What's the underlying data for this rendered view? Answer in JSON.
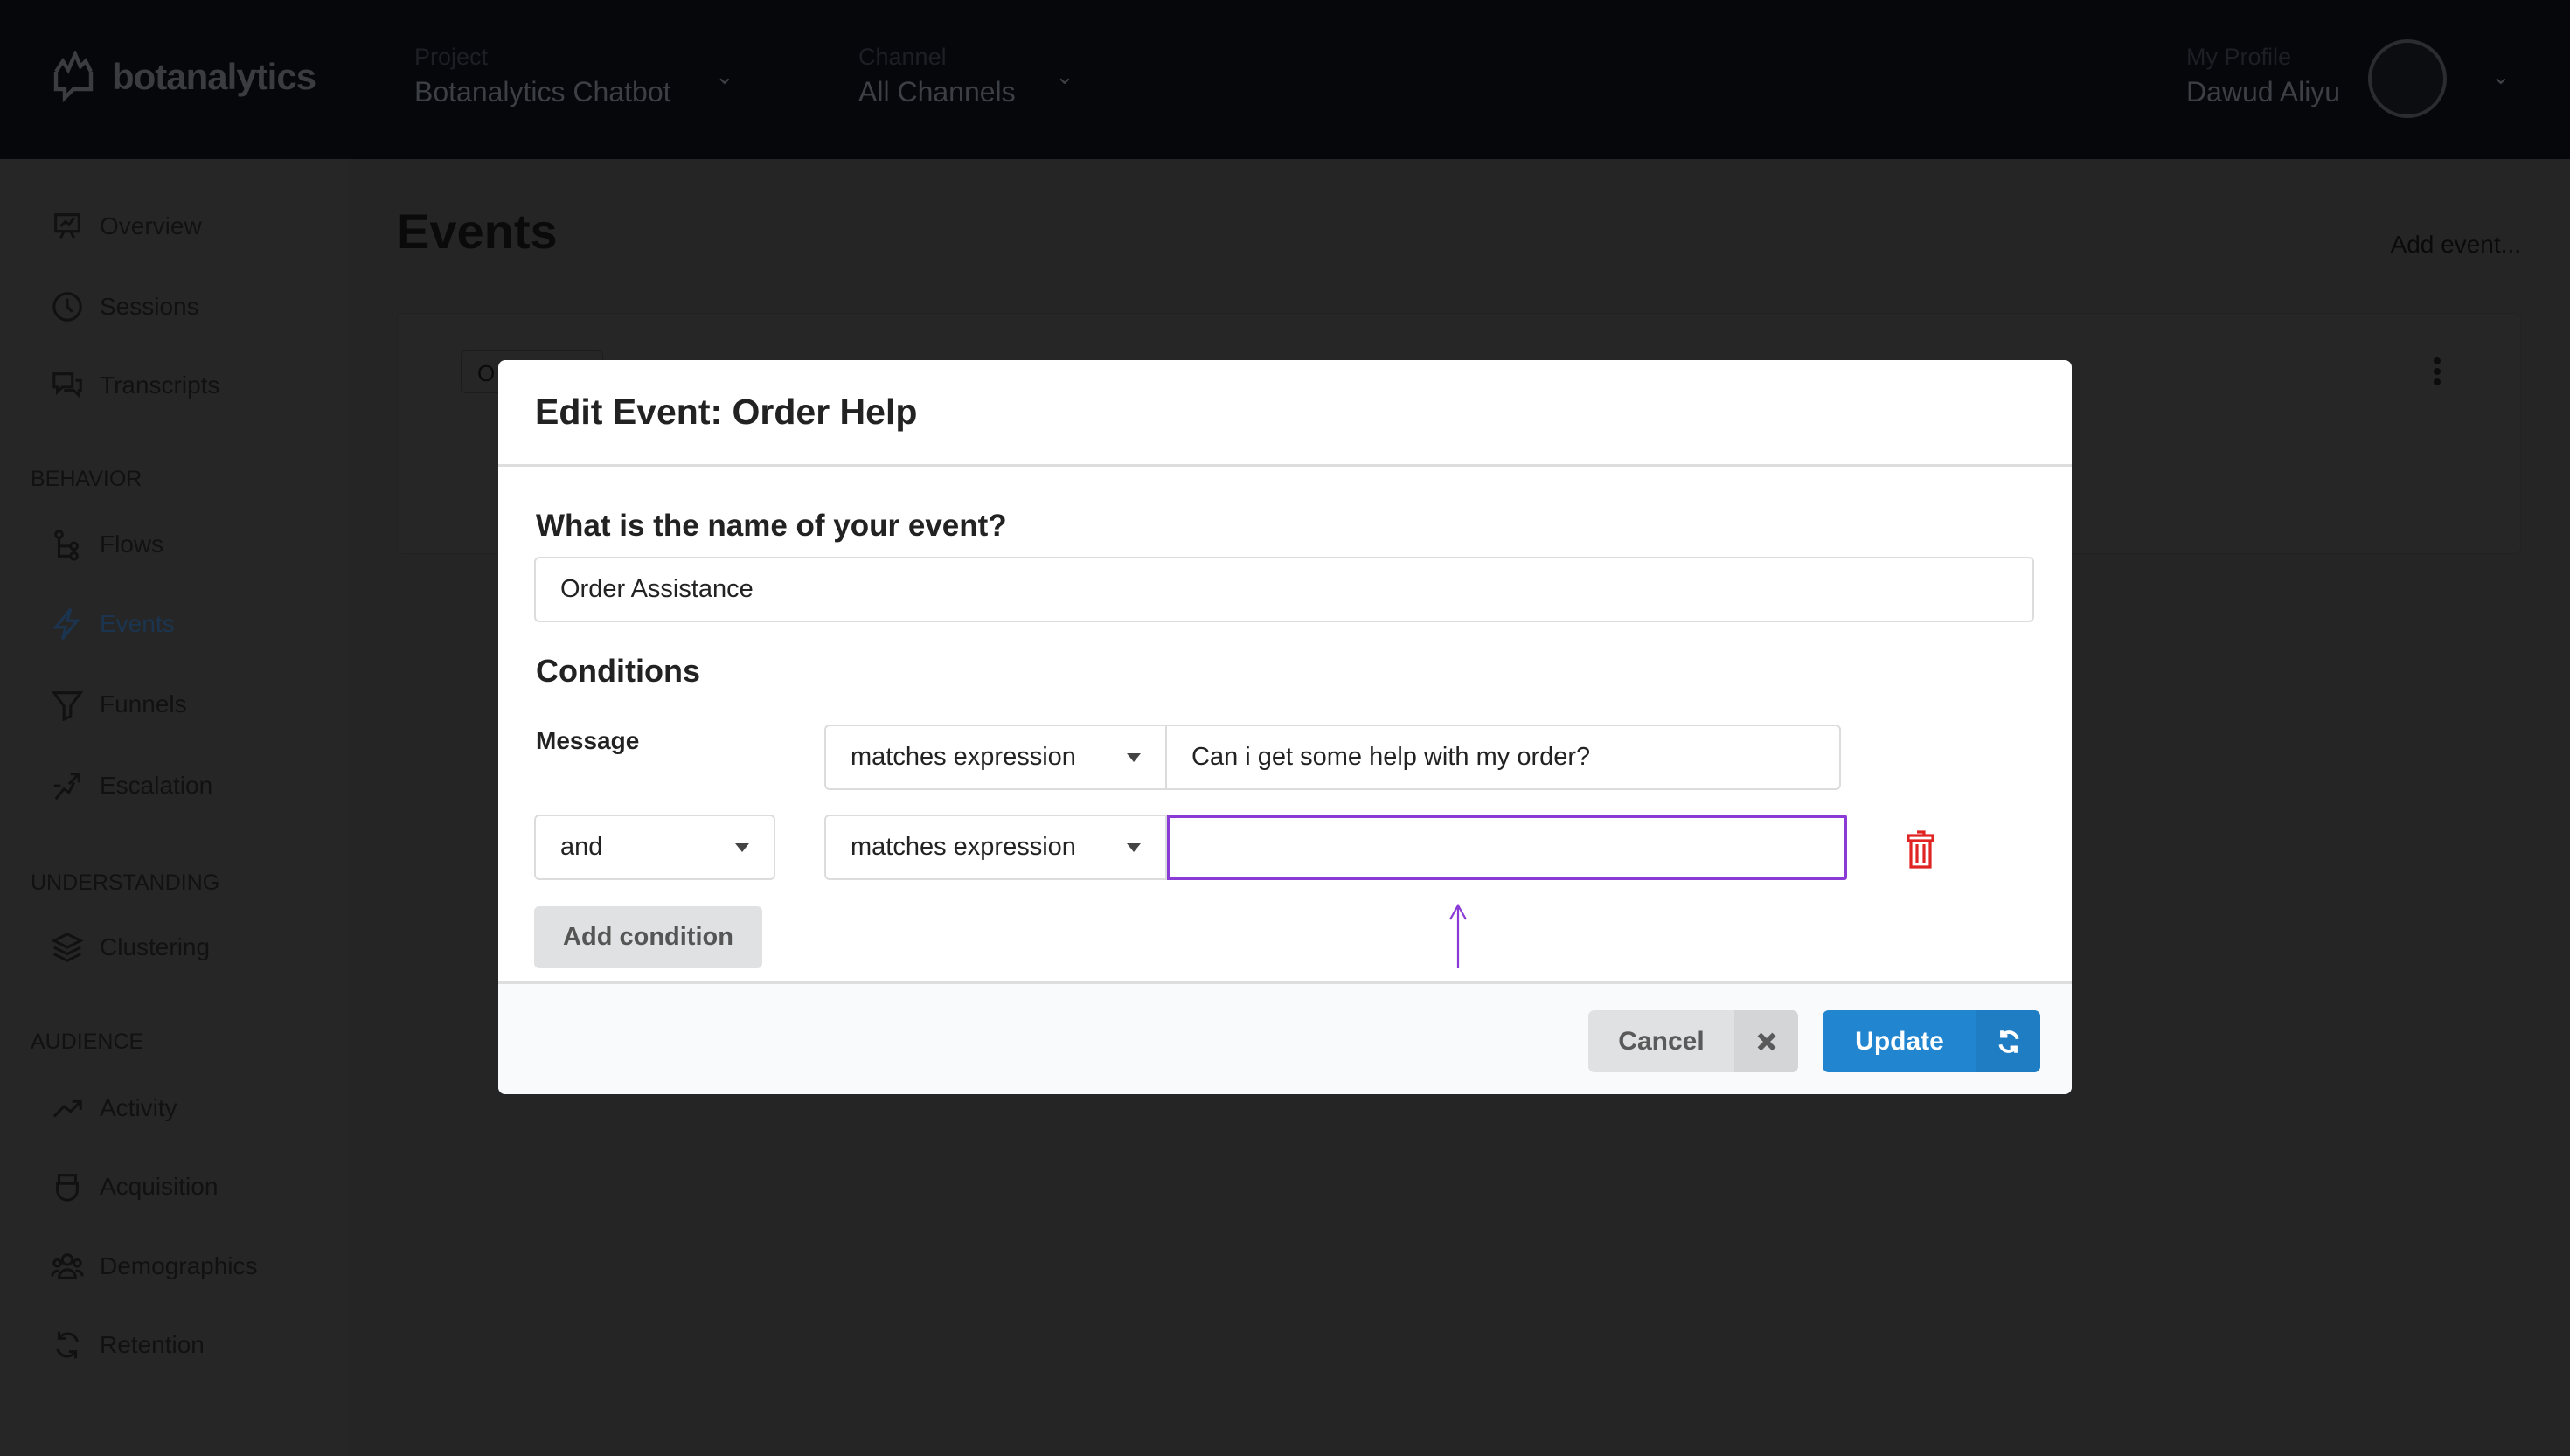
{
  "header": {
    "logo_text": "botanalytics",
    "project": {
      "label": "Project",
      "value": "Botanalytics Chatbot"
    },
    "channel": {
      "label": "Channel",
      "value": "All Channels"
    },
    "profile": {
      "label": "My Profile",
      "value": "Dawud Aliyu"
    }
  },
  "sidebar": {
    "items": [
      {
        "label": "Overview",
        "icon": "presentation-chart-icon"
      },
      {
        "label": "Sessions",
        "icon": "clock-icon"
      },
      {
        "label": "Transcripts",
        "icon": "chat-bubbles-icon"
      }
    ],
    "sections": [
      {
        "heading": "BEHAVIOR",
        "items": [
          {
            "label": "Flows",
            "icon": "flow-icon"
          },
          {
            "label": "Events",
            "icon": "bolt-icon",
            "active": true
          },
          {
            "label": "Funnels",
            "icon": "funnel-icon"
          },
          {
            "label": "Escalation",
            "icon": "escalation-icon"
          }
        ]
      },
      {
        "heading": "UNDERSTANDING",
        "items": [
          {
            "label": "Clustering",
            "icon": "layers-icon"
          }
        ]
      },
      {
        "heading": "AUDIENCE",
        "items": [
          {
            "label": "Activity",
            "icon": "trend-up-icon"
          },
          {
            "label": "Acquisition",
            "icon": "acquisition-icon"
          },
          {
            "label": "Demographics",
            "icon": "users-icon"
          },
          {
            "label": "Retention",
            "icon": "refresh-icon"
          }
        ]
      }
    ]
  },
  "page": {
    "title": "Events",
    "add_event": "Add event...",
    "card_chip": "O"
  },
  "modal": {
    "title": "Edit Event: Order Help",
    "name_question": "What is the name of your event?",
    "name_value": "Order Assistance",
    "conditions_heading": "Conditions",
    "row1": {
      "label": "Message",
      "operator": "matches expression",
      "value": "Can i get some help with my order?"
    },
    "row2": {
      "joiner": "and",
      "operator": "matches expression",
      "value": ""
    },
    "add_condition": "Add condition",
    "cancel": "Cancel",
    "update": "Update"
  },
  "colors": {
    "accent": "#2185d0",
    "focus": "#8a3bd6",
    "danger": "#e02424"
  }
}
